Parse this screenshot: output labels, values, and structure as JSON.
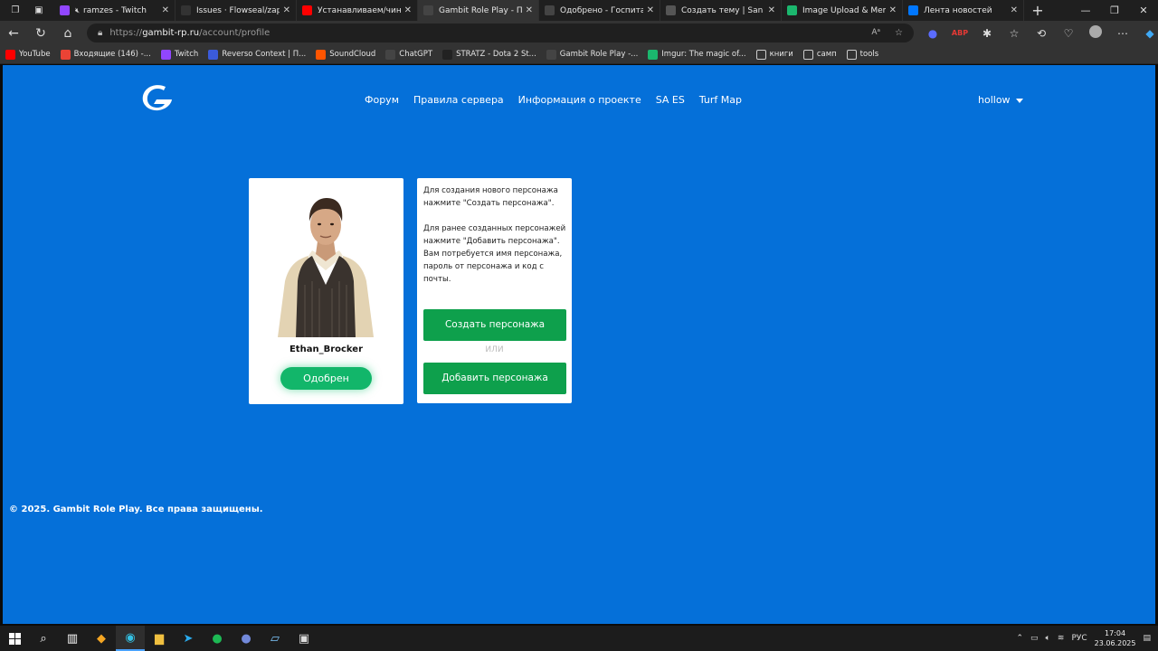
{
  "browser": {
    "tabs": [
      {
        "title": "ramzes - Twitch",
        "icon": "twitch-icon",
        "color": "#9146ff",
        "muted": true
      },
      {
        "title": "Issues · Flowseal/zapret-di",
        "icon": "github-icon",
        "color": "#333333"
      },
      {
        "title": "Устанавливаем/чиним Za",
        "icon": "youtube-icon",
        "color": "#ff0000"
      },
      {
        "title": "Gambit Role Play - Профи",
        "icon": "gambit-icon",
        "color": "#444444",
        "active": true
      },
      {
        "title": "Одобрено - Госпиталь Ва",
        "icon": "gambit-icon",
        "color": "#444444"
      },
      {
        "title": "Создать тему | San Andre",
        "icon": "forum-icon",
        "color": "#555555"
      },
      {
        "title": "Image Upload & Meme Ge",
        "icon": "imgur-icon",
        "color": "#1bb76e"
      },
      {
        "title": "Лента новостей",
        "icon": "vk-icon",
        "color": "#0077ff"
      }
    ],
    "address": {
      "scheme": "https://",
      "host": "gambit-rp.ru",
      "path": "/account/profile"
    },
    "bookmarks": [
      {
        "label": "YouTube",
        "icon": "youtube-icon",
        "color": "#ff0000"
      },
      {
        "label": "Входящие (146) -...",
        "icon": "gmail-icon",
        "color": "#ea4335"
      },
      {
        "label": "Twitch",
        "icon": "twitch-icon",
        "color": "#9146ff"
      },
      {
        "label": "Reverso Context | П...",
        "icon": "reverso-icon",
        "color": "#3b5bdb"
      },
      {
        "label": "SoundCloud",
        "icon": "soundcloud-icon",
        "color": "#ff5500"
      },
      {
        "label": "ChatGPT",
        "icon": "chatgpt-icon",
        "color": "#444444"
      },
      {
        "label": "STRATZ - Dota 2 St...",
        "icon": "stratz-icon",
        "color": "#222222"
      },
      {
        "label": "Gambit Role Play -...",
        "icon": "gambit-icon",
        "color": "#444444"
      },
      {
        "label": "Imgur: The magic of...",
        "icon": "imgur-icon",
        "color": "#1bb76e"
      },
      {
        "label": "книги",
        "icon": "folder-icon",
        "color": "#333333"
      },
      {
        "label": "самп",
        "icon": "folder-icon",
        "color": "#333333"
      },
      {
        "label": "tools",
        "icon": "folder-icon",
        "color": "#333333"
      }
    ]
  },
  "site": {
    "nav": [
      "Форум",
      "Правила сервера",
      "Информация о проекте",
      "SA ES",
      "Turf Map"
    ],
    "username": "hollow",
    "background": "#0570d9"
  },
  "character": {
    "name": "Ethan_Brocker",
    "status": "Одобрен"
  },
  "info": {
    "para1": "Для создания нового персонажа нажмите \"Создать персонажа\".",
    "para2": "Для ранее созданных персонажей нажмите \"Добавить персонажа\". Вам потребуется имя персонажа, пароль от персонажа и код с почты.",
    "create_label": "Создать персонажа",
    "or_label": "ИЛИ",
    "add_label": "Добавить персонажа"
  },
  "footer": {
    "text": "© 2025. Gambit Role Play. Все права защищены."
  },
  "taskbar": {
    "lang": "РУС",
    "time": "17:04",
    "date": "23.06.2025"
  }
}
